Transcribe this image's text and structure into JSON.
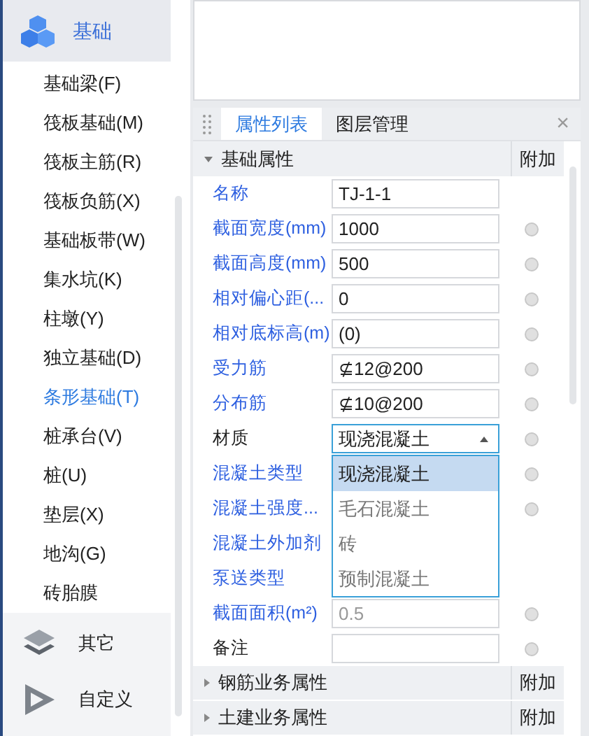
{
  "sidebar": {
    "group": {
      "label": "基础",
      "selected": true
    },
    "items": [
      {
        "label": "基础梁(F)",
        "selected": false
      },
      {
        "label": "筏板基础(M)",
        "selected": false
      },
      {
        "label": "筏板主筋(R)",
        "selected": false
      },
      {
        "label": "筏板负筋(X)",
        "selected": false
      },
      {
        "label": "基础板带(W)",
        "selected": false
      },
      {
        "label": "集水坑(K)",
        "selected": false
      },
      {
        "label": "柱墩(Y)",
        "selected": false
      },
      {
        "label": "独立基础(D)",
        "selected": false
      },
      {
        "label": "条形基础(T)",
        "selected": true
      },
      {
        "label": "桩承台(V)",
        "selected": false
      },
      {
        "label": "桩(U)",
        "selected": false
      },
      {
        "label": "垫层(X)",
        "selected": false
      },
      {
        "label": "地沟(G)",
        "selected": false
      },
      {
        "label": "砖胎膜",
        "selected": false
      }
    ],
    "groups": [
      {
        "label": "其它",
        "kind": "layers"
      },
      {
        "label": "自定义",
        "kind": "custom"
      }
    ]
  },
  "panel": {
    "tabs": [
      {
        "label": "属性列表",
        "selected": true
      },
      {
        "label": "图层管理",
        "selected": false
      }
    ],
    "close": "×",
    "section": {
      "label": "基础属性",
      "expanded": true,
      "extra": "附加"
    },
    "rows": [
      {
        "label": "名称",
        "highlighted": true,
        "value": "TJ-1-1",
        "attach": false
      },
      {
        "label": "截面宽度(mm)",
        "highlighted": true,
        "value": "1000",
        "attach": true
      },
      {
        "label": "截面高度(mm)",
        "highlighted": true,
        "value": "500",
        "attach": true
      },
      {
        "label": "相对偏心距(...",
        "highlighted": true,
        "value": "0",
        "attach": true
      },
      {
        "label": "相对底标高(m)",
        "highlighted": true,
        "value": "(0)",
        "attach": true
      },
      {
        "label": "受力筋",
        "highlighted": true,
        "value": "⊈12@200",
        "attach": true
      },
      {
        "label": "分布筋",
        "highlighted": true,
        "value": "⊈10@200",
        "attach": true
      },
      {
        "label": "材质",
        "highlighted": false,
        "value": "现浇混凝土",
        "kind": "dropdown",
        "attach": true,
        "options": [
          {
            "label": "现浇混凝土",
            "selected": true
          },
          {
            "label": "毛石混凝土",
            "selected": false
          },
          {
            "label": "砖",
            "selected": false
          },
          {
            "label": "预制混凝土",
            "selected": false
          }
        ]
      },
      {
        "label": "混凝土类型",
        "highlighted": true,
        "attach": true
      },
      {
        "label": "混凝土强度...",
        "highlighted": true,
        "attach": true
      },
      {
        "label": "混凝土外加剂",
        "highlighted": true,
        "attach": false
      },
      {
        "label": "泵送类型",
        "highlighted": true,
        "attach": false
      },
      {
        "label": "截面面积(m²)",
        "highlighted": true,
        "value": "0.5",
        "disabled": true,
        "attach": true
      },
      {
        "label": "备注",
        "highlighted": false,
        "value": "",
        "attach": true
      }
    ],
    "collapsed_sections": [
      {
        "label": "钢筋业务属性",
        "expanded": false,
        "extra": "附加"
      },
      {
        "label": "土建业务属性",
        "expanded": false,
        "extra": "附加"
      }
    ]
  }
}
